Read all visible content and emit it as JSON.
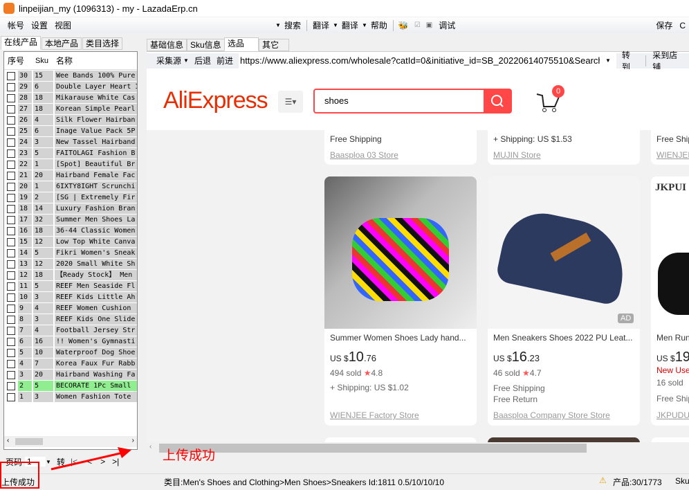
{
  "window": {
    "title": "linpeijian_my (1096313) - my - LazadaErp.cn"
  },
  "menu": {
    "items": [
      "帐号",
      "设置",
      "视图"
    ],
    "right": [
      "搜索",
      "翻译",
      "翻译",
      "帮助",
      "调试"
    ],
    "save": "保存",
    "cut": "C"
  },
  "left_tabs": [
    "在线产品",
    "本地产品",
    "类目选择"
  ],
  "table": {
    "headers": [
      "序号",
      "Sku",
      "名称"
    ],
    "rows": [
      [
        "30",
        "15",
        "Wee Bands 100% Pure"
      ],
      [
        "29",
        "6",
        "Double Layer Heart I"
      ],
      [
        "28",
        "18",
        "Mikarause White Cas"
      ],
      [
        "27",
        "18",
        "Korean Simple Pearl"
      ],
      [
        "26",
        "4",
        "Silk Flower Hairban"
      ],
      [
        "25",
        "6",
        "Inage Value Pack 5P"
      ],
      [
        "24",
        "3",
        "New Tassel Hairband"
      ],
      [
        "23",
        "5",
        "FAITOLAGI Fashion B"
      ],
      [
        "22",
        "1",
        "[Spot] Beautiful Br"
      ],
      [
        "21",
        "20",
        "Hairband Female Fac"
      ],
      [
        "20",
        "1",
        "6IXTY8IGHT Scrunchi"
      ],
      [
        "19",
        "2",
        "[SG | Extremely Fir"
      ],
      [
        "18",
        "14",
        "Luxury Fashion Bran"
      ],
      [
        "17",
        "32",
        "Summer Men Shoes La"
      ],
      [
        "16",
        "18",
        "36-44 Classic Women"
      ],
      [
        "15",
        "12",
        "Low Top White Canva"
      ],
      [
        "14",
        "5",
        "Fikri Women's Sneak"
      ],
      [
        "13",
        "12",
        "2020 Small White Sh"
      ],
      [
        "12",
        "18",
        "【Ready Stock】 Men"
      ],
      [
        "11",
        "5",
        "REEF Men Seaside Fl"
      ],
      [
        "10",
        "3",
        "REEF Kids Little Ah"
      ],
      [
        "9",
        "4",
        "REEF Women Cushion"
      ],
      [
        "8",
        "3",
        "REEF Kids One Slide"
      ],
      [
        "7",
        "4",
        "Football Jersey Str"
      ],
      [
        "6",
        "16",
        "!! Women's Gymnasti"
      ],
      [
        "5",
        "10",
        "Waterproof Dog Shoe"
      ],
      [
        "4",
        "7",
        "Korea Faux Fur Rabb"
      ],
      [
        "3",
        "20",
        "Hairband Washing Fa"
      ],
      [
        "2",
        "5",
        "BECORATE 1Pc Small"
      ],
      [
        "1",
        "3",
        "Women Fashion Tote"
      ]
    ],
    "selected_index": 28
  },
  "pager": {
    "label": "页码",
    "value": "1",
    "go": "转",
    "first": "|<",
    "prev": "<",
    "next": ">",
    "last": ">|"
  },
  "right_tabs": [
    "基础信息",
    "Sku信息",
    "选品",
    "其它"
  ],
  "browser_toolbar": {
    "source": "采集源",
    "back": "后退",
    "forward": "前进",
    "url": "https://www.aliexpress.com/wholesale?catId=0&initiative_id=SB_20220614075510&Search",
    "go": "转到",
    "collect": "采到店铺"
  },
  "aliexpress": {
    "logo": "AliExpress",
    "search_value": "shoes",
    "cart_count": "0",
    "brand_color": "#e62e04",
    "search_color": "#ff4747"
  },
  "cards_top": [
    {
      "line": "Free Shipping",
      "store": "Baasploa 03 Store"
    },
    {
      "line": "+ Shipping: US $1.53",
      "store": "MUJIN Store"
    },
    {
      "line": "Free Ship",
      "store": "WIENJEE"
    }
  ],
  "cards": [
    {
      "title": "Summer Women Shoes Lady hand...",
      "currency": "US $",
      "price_int": "10",
      "price_dec": ".76",
      "sold": "494 sold",
      "rating": "4.8",
      "ship": "+ Shipping: US $1.02",
      "extra": "",
      "store": "WIENJEE Factory Store"
    },
    {
      "title": "Men Sneakers Shoes 2022 PU Leat...",
      "currency": "US $",
      "price_int": "16",
      "price_dec": ".23",
      "sold": "46 sold",
      "rating": "4.7",
      "ship": "Free Shipping",
      "extra": "Free Return",
      "store": "Baasploa Company Store Store",
      "ad": "AD"
    },
    {
      "title": "Men Run",
      "currency": "US $",
      "price_int": "19",
      "new_user": "New Use",
      "sold": "16 sold",
      "ship": "Free Ship",
      "store": "JKPUDUN",
      "brand": "JKPUI"
    }
  ],
  "annotation": {
    "text": "上传成功",
    "color": "#ff0000"
  },
  "status": {
    "left": "上传成功",
    "category": "类目:Men's Shoes and Clothing>Men Shoes>Sneakers Id:1811  0.5/10/10/10",
    "products": "产品:30/1773",
    "sku": "Sku"
  }
}
